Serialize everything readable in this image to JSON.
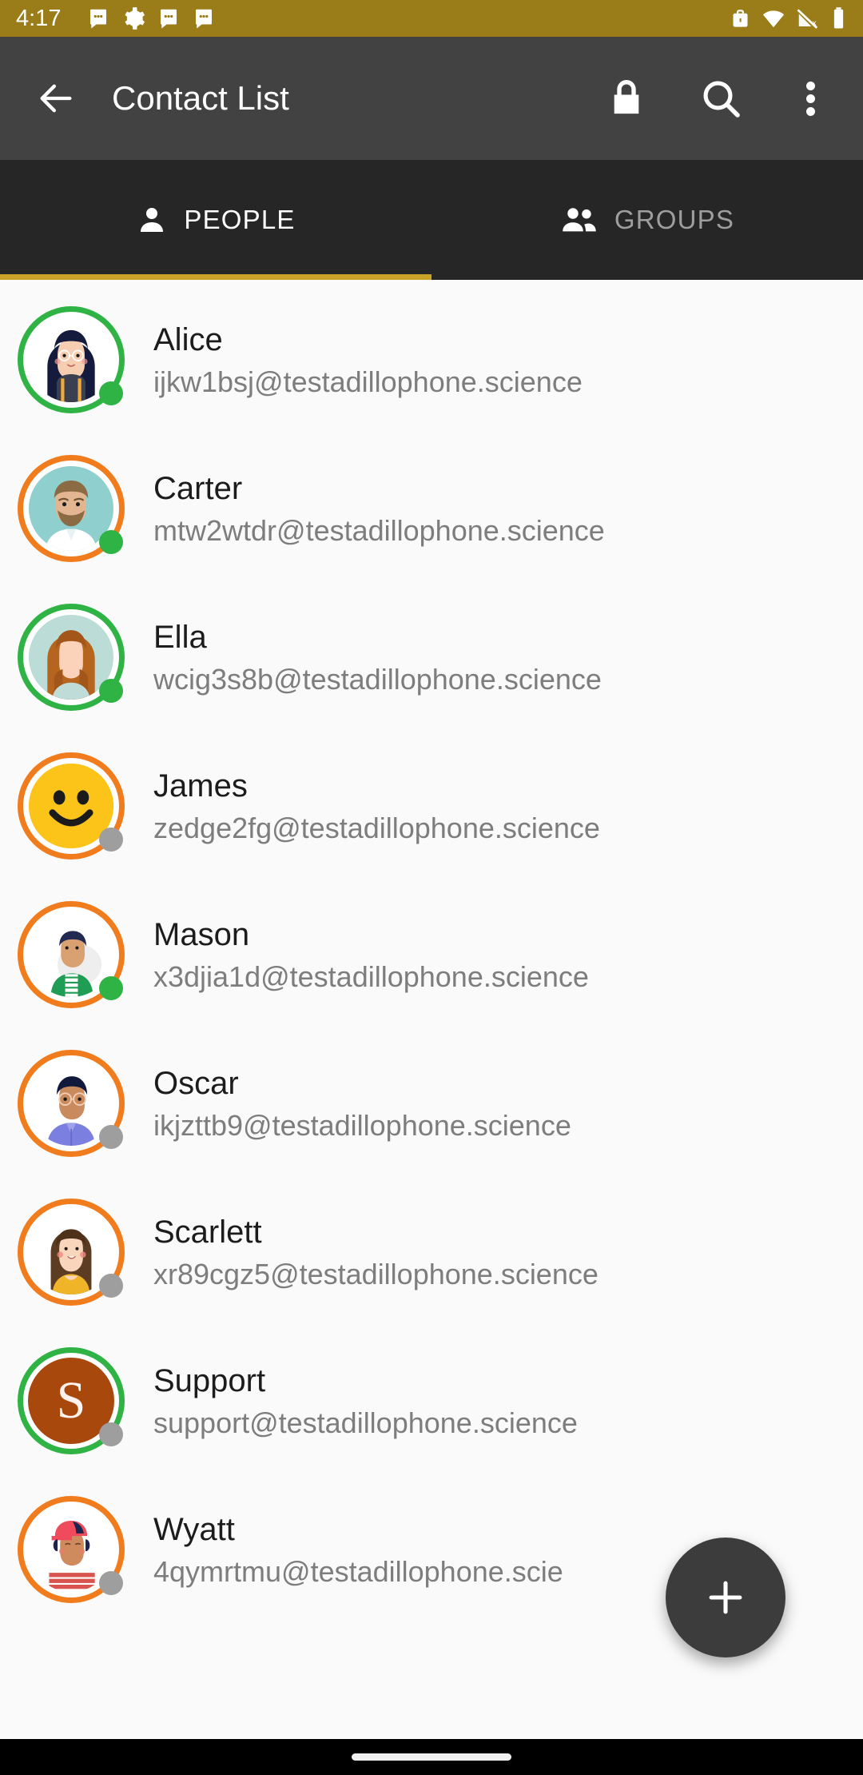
{
  "status_bar": {
    "time": "4:17",
    "background": "#9a7d18",
    "left_icons": [
      "message-icon",
      "settings-gear-icon",
      "message-icon",
      "message-icon"
    ],
    "right_icons": [
      "work-profile-icon",
      "wifi-icon",
      "cellular-off-icon",
      "battery-icon"
    ]
  },
  "app_bar": {
    "title": "Contact List",
    "background": "#424242",
    "back_icon": "back-arrow-icon",
    "actions": [
      "lock-icon",
      "search-icon",
      "overflow-menu-icon"
    ]
  },
  "tabs": {
    "background": "#262626",
    "indicator_color": "#c9a227",
    "items": [
      {
        "label": "PEOPLE",
        "icon": "person-icon",
        "active": true
      },
      {
        "label": "GROUPS",
        "icon": "people-group-icon",
        "active": false
      }
    ]
  },
  "contacts": [
    {
      "name": "Alice",
      "email": "ijkw1bsj@testadillophone.science",
      "ring_color": "#2fb344",
      "status": "online",
      "status_color": "#2fb344",
      "avatar_type": "illustration",
      "avatar_background": "#ffffff",
      "avatar_description": "woman-with-long-dark-hair-and-glasses"
    },
    {
      "name": "Carter",
      "email": "mtw2wtdr@testadillophone.science",
      "ring_color": "#f07c1e",
      "status": "online",
      "status_color": "#2fb344",
      "avatar_type": "illustration",
      "avatar_background": "#8fcfce",
      "avatar_description": "bearded-man-in-white-shirt"
    },
    {
      "name": "Ella",
      "email": "wcig3s8b@testadillophone.science",
      "ring_color": "#2fb344",
      "status": "online",
      "status_color": "#2fb344",
      "avatar_type": "illustration",
      "avatar_background": "#bcdcd8",
      "avatar_description": "woman-with-auburn-hair"
    },
    {
      "name": "James",
      "email": "zedge2fg@testadillophone.science",
      "ring_color": "#f07c1e",
      "status": "offline",
      "status_color": "#9e9e9e",
      "avatar_type": "emoji",
      "avatar_background": "#fcc419",
      "avatar_description": "yellow-smiley-face"
    },
    {
      "name": "Mason",
      "email": "x3djia1d@testadillophone.science",
      "ring_color": "#f07c1e",
      "status": "online",
      "status_color": "#2fb344",
      "avatar_type": "illustration",
      "avatar_background": "#ffffff",
      "avatar_description": "man-in-green-jacket"
    },
    {
      "name": "Oscar",
      "email": "ikjzttb9@testadillophone.science",
      "ring_color": "#f07c1e",
      "status": "offline",
      "status_color": "#9e9e9e",
      "avatar_type": "illustration",
      "avatar_background": "#ffffff",
      "avatar_description": "man-with-glasses-in-purple-shirt"
    },
    {
      "name": "Scarlett",
      "email": "xr89cgz5@testadillophone.science",
      "ring_color": "#f07c1e",
      "status": "offline",
      "status_color": "#9e9e9e",
      "avatar_type": "illustration",
      "avatar_background": "#ffffff",
      "avatar_description": "woman-with-bob-haircut-in-yellow-top"
    },
    {
      "name": "Support",
      "email": "support@testadillophone.science",
      "ring_color": "#2fb344",
      "status": "offline",
      "status_color": "#9e9e9e",
      "avatar_type": "initial",
      "avatar_background": "#a8480d",
      "initial": "S",
      "avatar_description": "letter-avatar"
    },
    {
      "name": "Wyatt",
      "email": "4qymrtmu@testadillophone.scie",
      "ring_color": "#f07c1e",
      "status": "offline",
      "status_color": "#9e9e9e",
      "avatar_type": "illustration",
      "avatar_background": "#ffffff",
      "avatar_description": "person-with-red-cap-and-striped-shirt"
    }
  ],
  "fab": {
    "icon": "plus-icon",
    "background": "#3c3c3c"
  },
  "nav_bar": {
    "background": "#000000",
    "gesture_pill": "home-gesture-pill"
  }
}
